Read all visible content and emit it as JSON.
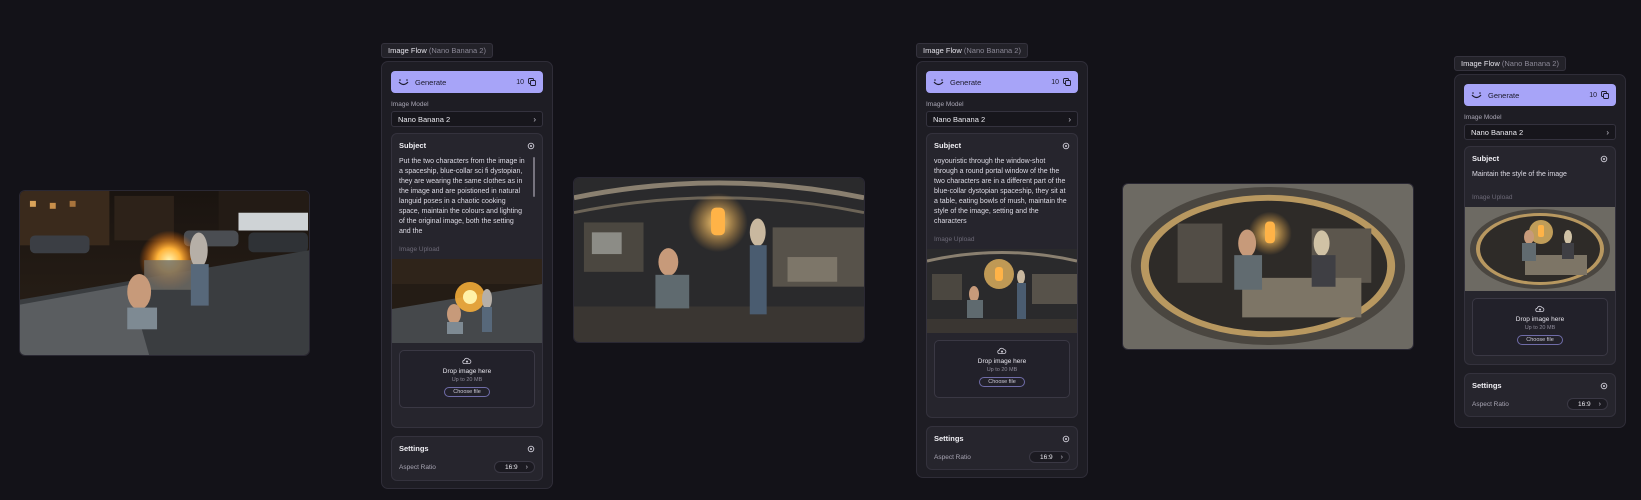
{
  "panels": [
    {
      "tag_title": "Image Flow",
      "tag_model": "(Nano Banana 2)",
      "generate_label": "Generate",
      "credits": "10",
      "image_model_label": "Image Model",
      "image_model_value": "Nano Banana 2",
      "subject_title": "Subject",
      "subject_text": "Put the two characters from the image in a spaceship, blue-collar sci fi dystopian, they are wearing the same clothes as in the image and are poistioned in natural languid poses in a chaotic cooking space, maintain the colours and lighting of the original image, both the setting and the",
      "upload_label": "Image Upload",
      "drop_title": "Drop image here",
      "drop_sub": "Up to 20 MB",
      "choose_label": "Choose file",
      "settings_title": "Settings",
      "aspect_label": "Aspect Ratio",
      "aspect_value": "16:9"
    },
    {
      "tag_title": "Image Flow",
      "tag_model": "(Nano Banana 2)",
      "generate_label": "Generate",
      "credits": "10",
      "image_model_label": "Image Model",
      "image_model_value": "Nano Banana 2",
      "subject_title": "Subject",
      "subject_text": "voyouristic through the window-shot through a round portal window of the the two characters are in a different part of the blue-collar dystopian spaceship, they sit at a table, eating bowls of mush, maintain the style of the image, setting and the characters",
      "upload_label": "Image Upload",
      "drop_title": "Drop image here",
      "drop_sub": "Up to 20 MB",
      "choose_label": "Choose file",
      "settings_title": "Settings",
      "aspect_label": "Aspect Ratio",
      "aspect_value": "16:9"
    },
    {
      "tag_title": "Image Flow",
      "tag_model": "(Nano Banana 2)",
      "generate_label": "Generate",
      "credits": "10",
      "image_model_label": "Image Model",
      "image_model_value": "Nano Banana 2",
      "subject_title": "Subject",
      "subject_text": "Maintain the style of the image",
      "upload_label": "Image Upload",
      "drop_title": "Drop image here",
      "drop_sub": "Up to 20 MB",
      "choose_label": "Choose file",
      "settings_title": "Settings",
      "aspect_label": "Aspect Ratio",
      "aspect_value": "16:9"
    }
  ],
  "colors": {
    "canvas_bg": "#131218",
    "panel_bg": "#1e1d24",
    "generate_accent": "#a7a4f8"
  },
  "icons": [
    "sparkle-icon",
    "credits-icon",
    "chevron-right-icon",
    "gear-icon",
    "cloud-upload-icon"
  ]
}
